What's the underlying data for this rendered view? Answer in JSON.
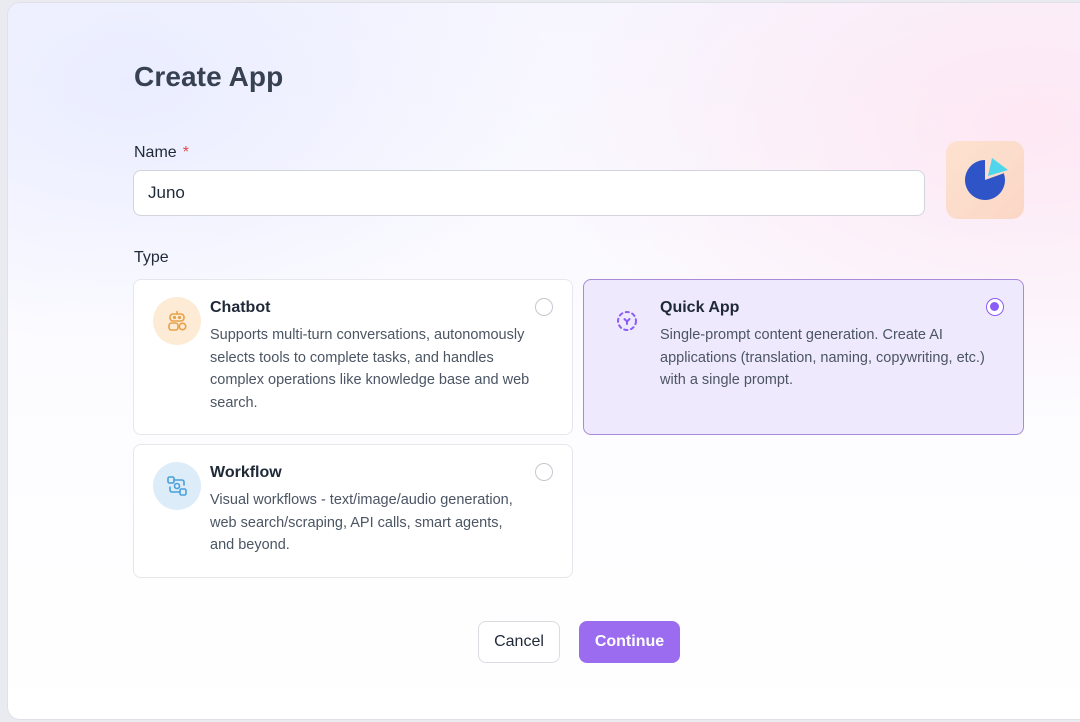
{
  "dialog": {
    "title": "Create App",
    "name_label": "Name",
    "required_mark": "*",
    "name_value": "Juno",
    "type_label": "Type"
  },
  "types": [
    {
      "title": "Chatbot",
      "description": "Supports multi-turn conversations, autonomously selects tools to complete tasks, and handles complex operations like knowledge base and web search.",
      "icon": "robot-icon",
      "selected": false
    },
    {
      "title": "Quick App",
      "description": "Single-prompt content generation. Create AI applications (translation, naming, copywriting, etc.) with a single prompt.",
      "icon": "sparkle-circle-icon",
      "selected": true
    },
    {
      "title": "Workflow",
      "description": "Visual workflows - text/image/audio generation, web search/scraping, API calls, smart agents, and beyond.",
      "icon": "workflow-icon",
      "selected": false
    }
  ],
  "buttons": {
    "cancel": "Cancel",
    "continue": "Continue"
  },
  "colors": {
    "accent": "#9b6cf0",
    "selected_card_bg": "#efe9fd",
    "required": "#e5484d",
    "app_icon_bg": "#fde2cf",
    "app_icon_pie": "#2f54c8",
    "app_icon_slice": "#4fd6ec"
  }
}
